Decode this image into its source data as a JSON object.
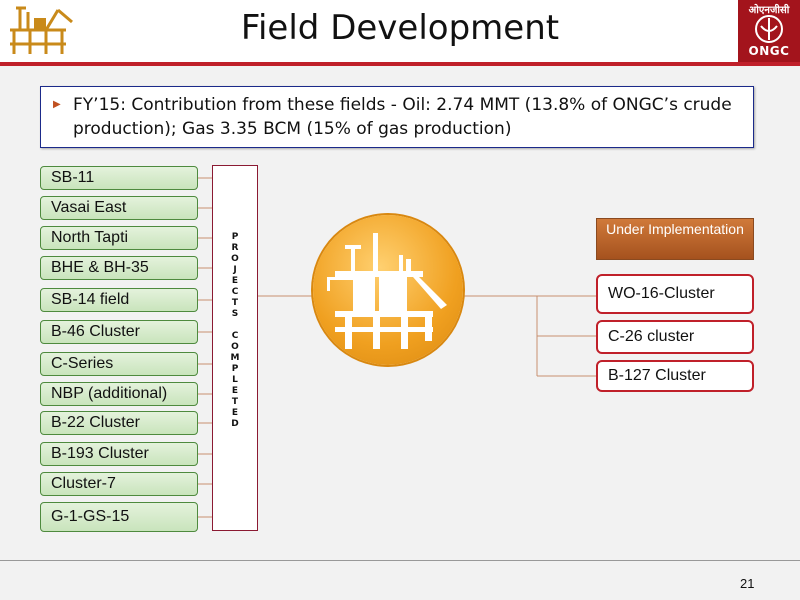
{
  "header": {
    "title": "Field Development",
    "logo_right_text": "ONGC",
    "logo_right_hindi": "ओएनजीसी"
  },
  "callout": {
    "text": "FY’15: Contribution from these fields - Oil: 2.74 MMT (13.8% of ONGC’s crude production); Gas 3.35 BCM (15% of gas production)"
  },
  "completed": {
    "label": "P\nR\nO\nJ\nE\nC\nT\nS\n\nC\nO\nM\nP\nL\nE\nT\nE\nD",
    "fields": [
      "SB-11",
      "Vasai East",
      "North Tapti",
      "BHE & BH-35",
      "SB-14 field",
      "B-46 Cluster",
      "C-Series",
      "NBP (additional)",
      "B-22 Cluster",
      "B-193 Cluster",
      "Cluster-7",
      "G-1-GS-15"
    ]
  },
  "under_implementation": {
    "label": "Under Implementation",
    "clusters": [
      "WO-16-Cluster",
      "C-26 cluster",
      "B-127 Cluster"
    ]
  },
  "footer": {
    "page_number": "21"
  },
  "colors": {
    "accent_red": "#c0202a",
    "field_green": "#c9e4bc",
    "hub_orange": "#f0a020",
    "callout_border": "#1b2a8a"
  },
  "icons": [
    "oil-platform-icon",
    "ongc-logo-icon",
    "bullet-arrow-icon"
  ]
}
